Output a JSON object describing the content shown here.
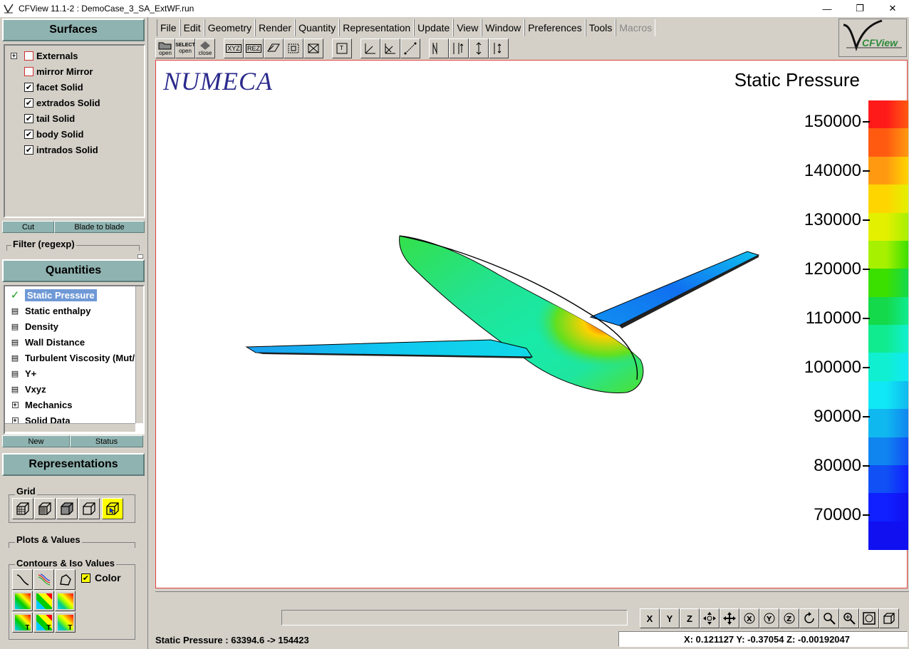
{
  "window": {
    "title": "CFView 11.1-2 : DemoCase_3_SA_ExtWF.run",
    "minimize": "—",
    "maximize": "❐",
    "close": "✕"
  },
  "surfaces": {
    "header": "Surfaces",
    "items": [
      {
        "label": "Externals",
        "checked": false,
        "expandable": true
      },
      {
        "label": "mirror Mirror",
        "checked": false,
        "expandable": false
      },
      {
        "label": "facet Solid",
        "checked": true,
        "expandable": false
      },
      {
        "label": "extrados Solid",
        "checked": true,
        "expandable": false
      },
      {
        "label": "tail Solid",
        "checked": true,
        "expandable": false
      },
      {
        "label": "body Solid",
        "checked": true,
        "expandable": false
      },
      {
        "label": "intrados Solid",
        "checked": true,
        "expandable": false
      }
    ],
    "cut_button": "Cut",
    "blade_button": "Blade to blade",
    "filter_label": "Filter (regexp)"
  },
  "quantities": {
    "header": "Quantities",
    "items": [
      {
        "label": "Static Pressure",
        "icon": "check-icon"
      },
      {
        "label": "Static enthalpy",
        "icon": "doc-icon"
      },
      {
        "label": "Density",
        "icon": "doc-icon"
      },
      {
        "label": "Wall Distance",
        "icon": "doc-icon"
      },
      {
        "label": "Turbulent Viscosity (Mut/",
        "icon": "doc-icon"
      },
      {
        "label": "Y+",
        "icon": "doc-icon"
      },
      {
        "label": "Vxyz",
        "icon": "doc-icon"
      },
      {
        "label": "Mechanics",
        "icon": "plus-icon"
      },
      {
        "label": "Solid Data",
        "icon": "plus-icon"
      }
    ],
    "new_button": "New",
    "status_button": "Status"
  },
  "representations": {
    "header": "Representations",
    "grid_label": "Grid",
    "plots_label": "Plots & Values",
    "contours_label": "Contours & Iso Values",
    "color_label": "Color",
    "color_checked": true
  },
  "menu": [
    "File",
    "Edit",
    "Geometry",
    "Render",
    "Quantity",
    "Representation",
    "Update",
    "View",
    "Window",
    "Preferences",
    "Tools",
    "Macros"
  ],
  "toolbar": {
    "open1": "open",
    "select": "SELECT",
    "open2": "open",
    "close": "close",
    "xyz": "XYZ",
    "rez": "REZ"
  },
  "logo_text": "CFView",
  "viewport": {
    "brand": "NUMECA",
    "legend_title": "Static Pressure",
    "ticks": [
      "150000",
      "140000",
      "130000",
      "120000",
      "110000",
      "100000",
      "90000",
      "80000",
      "70000"
    ],
    "colors": [
      "#ff1a1a",
      "#ff5a10",
      "#ff9a10",
      "#ffd500",
      "#e3f000",
      "#a6f000",
      "#3ce000",
      "#14d94a",
      "#10eb90",
      "#10f0d0",
      "#10e8f5",
      "#10b8f0",
      "#1085f0",
      "#1050f5",
      "#1020ff",
      "#1010f0"
    ]
  },
  "status": {
    "range_text": "Static Pressure :  63394.6  ->  154423",
    "coords_text": "X: 0.121127   Y: -0.37054   Z: -0.00192047"
  },
  "nav": [
    "X",
    "Y",
    "Z"
  ]
}
